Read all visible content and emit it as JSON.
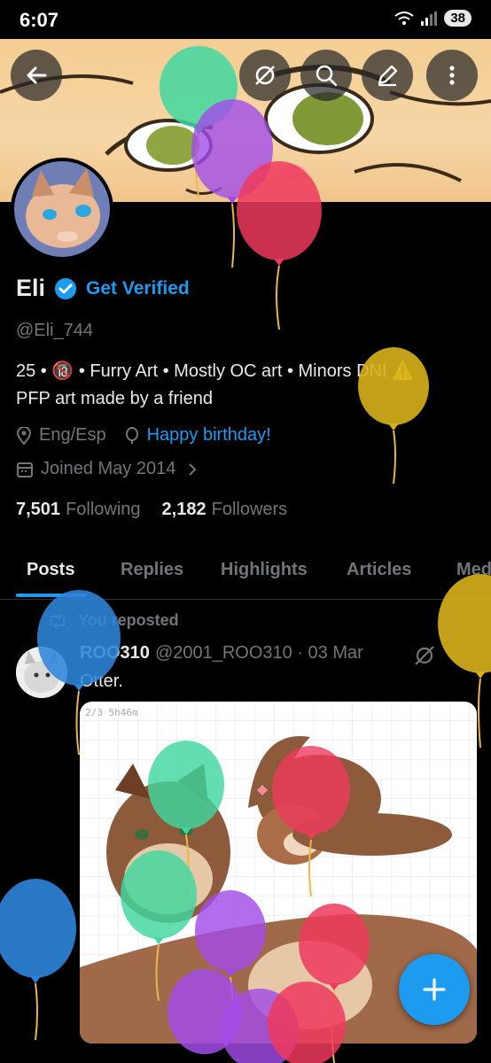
{
  "status_bar": {
    "time": "6:07",
    "signal": "5",
    "battery": "38"
  },
  "profile": {
    "name": "Eli",
    "get_verified": "Get Verified",
    "handle": "@Eli_744",
    "bio_line1": "25 • 🔞 • Furry Art • Mostly OC art • Minors DNI ⚠️",
    "bio_line2": "PFP art made by a friend",
    "location": "Eng/Esp",
    "birthday": "Happy birthday!",
    "joined": "Joined May 2014",
    "following_count": "7,501",
    "following_label": "Following",
    "followers_count": "2,182",
    "followers_label": "Followers"
  },
  "tabs": [
    "Posts",
    "Replies",
    "Highlights",
    "Articles",
    "Media"
  ],
  "post": {
    "repost_label": "You reposted",
    "author": "ROO310",
    "author_handle": "@2001_ROO310",
    "date": "· 03 Mar",
    "text": "Otter.",
    "image_label": "2/3  5h46m"
  },
  "icons": {
    "back": "back-arrow-icon",
    "translate": "translate-icon",
    "search": "search-icon",
    "edit": "edit-icon",
    "more": "more-icon",
    "location": "location-icon",
    "balloon": "balloon-icon",
    "calendar": "calendar-icon",
    "chevron": "chevron-right-icon",
    "repost": "repost-icon",
    "compose": "plus-icon"
  },
  "colors": {
    "accent": "#1d9bf0",
    "background": "#000000",
    "text": "#e7e9ea",
    "muted": "#71767b"
  }
}
